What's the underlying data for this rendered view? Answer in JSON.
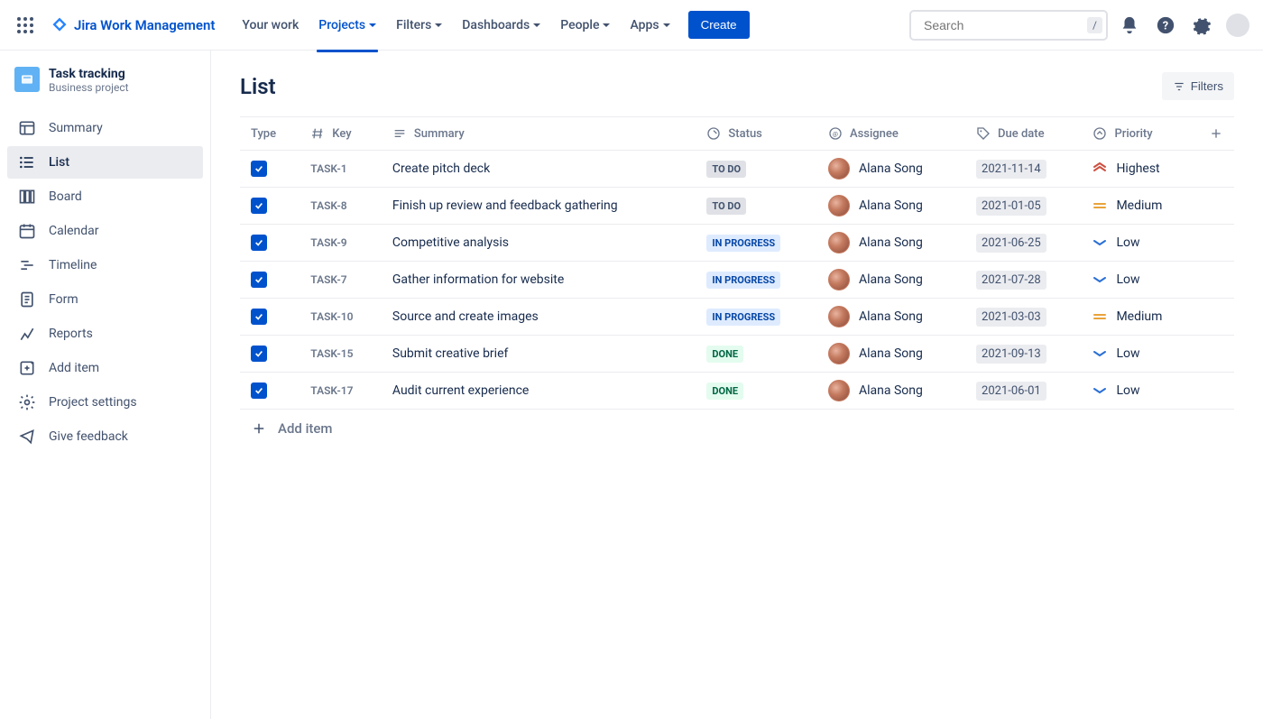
{
  "topnav": {
    "product": "Jira Work Management",
    "items": [
      {
        "label": "Your work",
        "dropdown": false,
        "active": false
      },
      {
        "label": "Projects",
        "dropdown": true,
        "active": true
      },
      {
        "label": "Filters",
        "dropdown": true,
        "active": false
      },
      {
        "label": "Dashboards",
        "dropdown": true,
        "active": false
      },
      {
        "label": "People",
        "dropdown": true,
        "active": false
      },
      {
        "label": "Apps",
        "dropdown": true,
        "active": false
      }
    ],
    "create": "Create",
    "search_placeholder": "Search",
    "search_kbd": "/"
  },
  "sidebar": {
    "project_name": "Task tracking",
    "project_type": "Business project",
    "items": [
      {
        "label": "Summary",
        "icon": "summary"
      },
      {
        "label": "List",
        "icon": "list",
        "active": true
      },
      {
        "label": "Board",
        "icon": "board"
      },
      {
        "label": "Calendar",
        "icon": "calendar"
      },
      {
        "label": "Timeline",
        "icon": "timeline"
      },
      {
        "label": "Form",
        "icon": "form"
      },
      {
        "label": "Reports",
        "icon": "reports"
      },
      {
        "label": "Add item",
        "icon": "additem"
      },
      {
        "label": "Project settings",
        "icon": "settings"
      },
      {
        "label": "Give feedback",
        "icon": "feedback"
      }
    ]
  },
  "page": {
    "title": "List",
    "filters_btn": "Filters",
    "add_item": "Add item"
  },
  "columns": {
    "type": "Type",
    "key": "Key",
    "summary": "Summary",
    "status": "Status",
    "assignee": "Assignee",
    "due": "Due date",
    "priority": "Priority"
  },
  "rows": [
    {
      "key": "TASK-1",
      "summary": "Create pitch deck",
      "status": "TO DO",
      "status_class": "todo",
      "assignee": "Alana Song",
      "due": "2021-11-14",
      "priority": "Highest",
      "priority_icon": "highest"
    },
    {
      "key": "TASK-8",
      "summary": "Finish up review and feedback gathering",
      "status": "TO DO",
      "status_class": "todo",
      "assignee": "Alana Song",
      "due": "2021-01-05",
      "priority": "Medium",
      "priority_icon": "medium"
    },
    {
      "key": "TASK-9",
      "summary": "Competitive analysis",
      "status": "IN PROGRESS",
      "status_class": "progress",
      "assignee": "Alana Song",
      "due": "2021-06-25",
      "priority": "Low",
      "priority_icon": "low"
    },
    {
      "key": "TASK-7",
      "summary": "Gather information for website",
      "status": "IN PROGRESS",
      "status_class": "progress",
      "assignee": "Alana Song",
      "due": "2021-07-28",
      "priority": "Low",
      "priority_icon": "low"
    },
    {
      "key": "TASK-10",
      "summary": "Source and create images",
      "status": "IN PROGRESS",
      "status_class": "progress",
      "assignee": "Alana Song",
      "due": "2021-03-03",
      "priority": "Medium",
      "priority_icon": "medium"
    },
    {
      "key": "TASK-15",
      "summary": "Submit creative brief",
      "status": "DONE",
      "status_class": "done",
      "assignee": "Alana Song",
      "due": "2021-09-13",
      "priority": "Low",
      "priority_icon": "low"
    },
    {
      "key": "TASK-17",
      "summary": "Audit current experience",
      "status": "DONE",
      "status_class": "done",
      "assignee": "Alana Song",
      "due": "2021-06-01",
      "priority": "Low",
      "priority_icon": "low"
    }
  ]
}
